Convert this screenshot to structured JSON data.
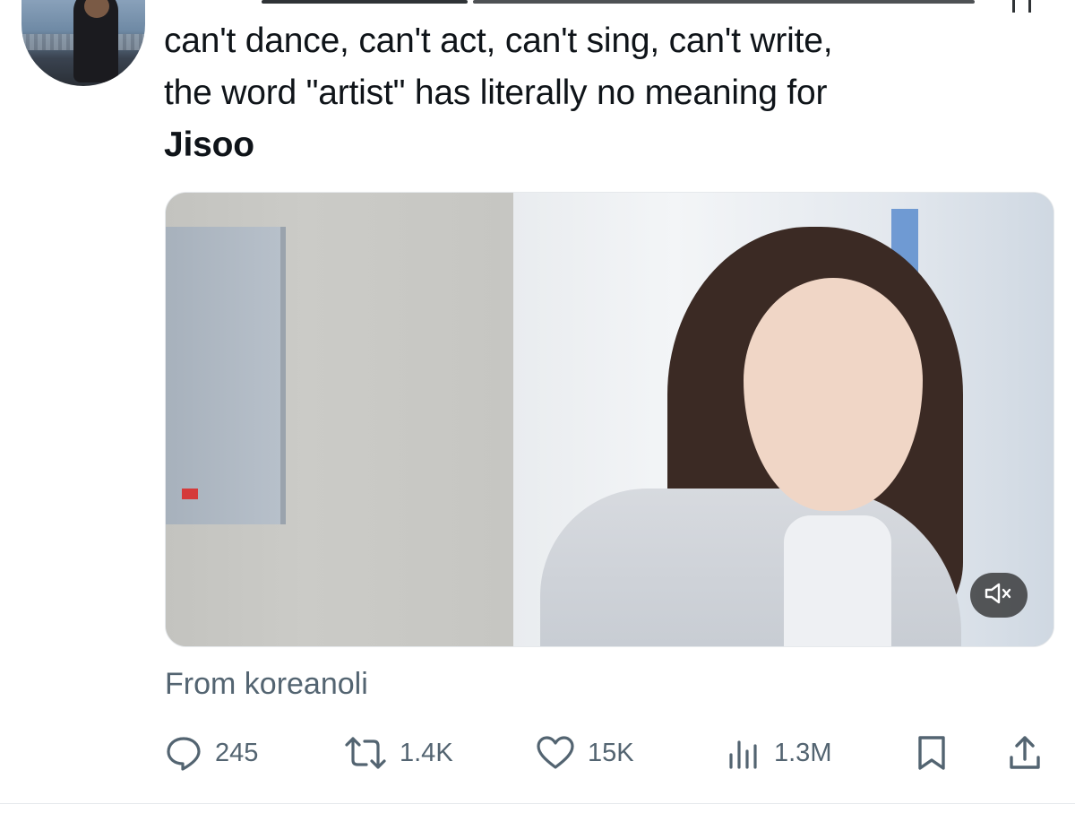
{
  "tweet": {
    "text_lines": [
      "can't dance, can't act, can't sing, can't write,",
      "the word \"artist\" has literally no meaning for"
    ],
    "bold_word": "Jisoo"
  },
  "media": {
    "type": "video",
    "mute_icon": "speaker-muted-icon"
  },
  "source": {
    "prefix": "From",
    "name": "koreanoli"
  },
  "actions": {
    "replies": "245",
    "reposts": "1.4K",
    "likes": "15K",
    "views": "1.3M"
  },
  "colors": {
    "text": "#0f1419",
    "secondary": "#536471"
  }
}
